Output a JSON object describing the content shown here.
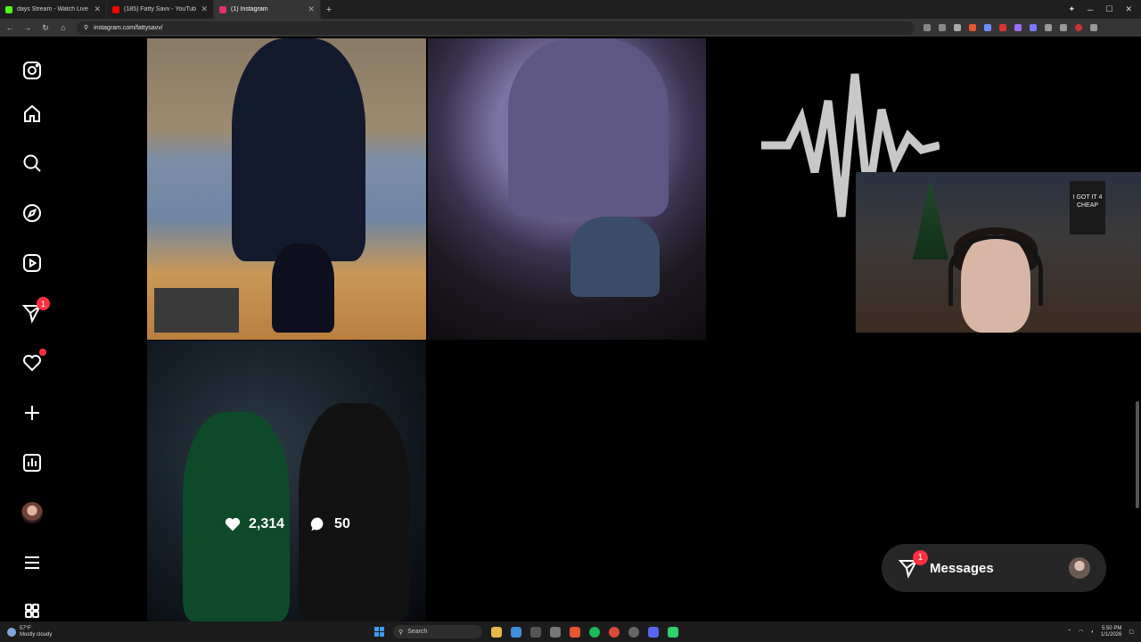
{
  "browser": {
    "tabs": [
      {
        "title": "days Stream - Watch Live on K",
        "color": "#53fc18",
        "active": false
      },
      {
        "title": "(185) Fatty Savv - YouTube",
        "color": "#ff0000",
        "active": false
      },
      {
        "title": "(1) Instagram",
        "color": "#e1306c",
        "active": true
      }
    ],
    "new_tab_glyph": "+",
    "url": "instagram.com/fattysavv/"
  },
  "leftnav": {
    "notifications_badge": "1"
  },
  "posts": {
    "hover": {
      "likes": "2,314",
      "comments": "50"
    },
    "poster_text": "I GOT IT 4 CHEAP"
  },
  "messages": {
    "label": "Messages",
    "badge": "1"
  },
  "taskbar": {
    "temp": "57°F",
    "weather": "Mostly cloudy",
    "search": "Search",
    "time": "5:50 PM",
    "date": "1/1/2026"
  },
  "colors": {
    "accent_badge": "#ff3040"
  }
}
